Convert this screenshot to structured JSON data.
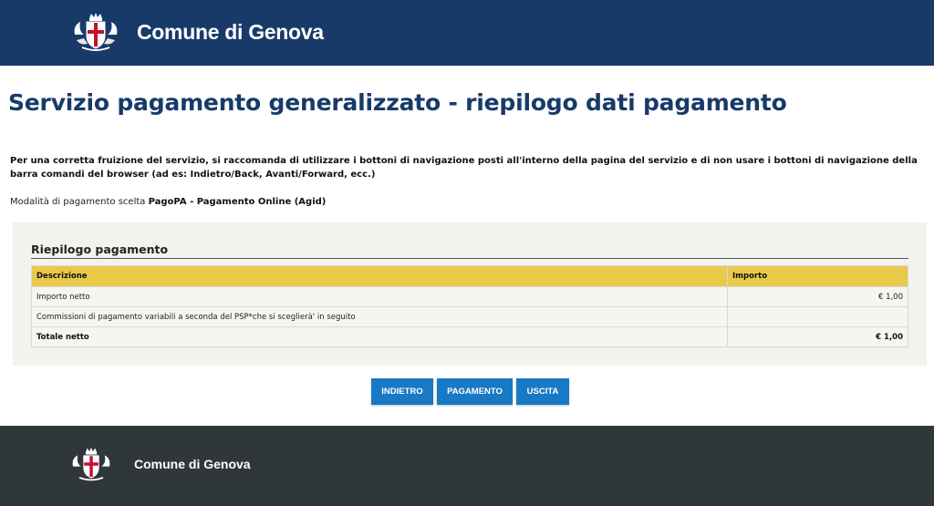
{
  "header": {
    "site_name": "Comune di Genova"
  },
  "page": {
    "title": "Servizio pagamento generalizzato - riepilogo dati pagamento"
  },
  "notice": "Per una corretta fruizione del servizio, si raccomanda di utilizzare i bottoni di navigazione posti all'interno della pagina del servizio e di non usare i bottoni di navigazione della barra comandi del browser (ad es: Indietro/Back, Avanti/Forward, ecc.)",
  "payment_method": {
    "label": "Modalità di pagamento scelta",
    "value": "PagoPA - Pagamento Online (Agid)"
  },
  "summary": {
    "title": "Riepilogo pagamento",
    "columns": {
      "description": "Descrizione",
      "amount": "Importo"
    },
    "rows": [
      {
        "description": "Importo netto",
        "amount": "€ 1,00"
      },
      {
        "description": "Commissioni di pagamento variabili a seconda del PSP*che si sceglierà' in seguito",
        "amount": ""
      }
    ],
    "total": {
      "description": "Totale netto",
      "amount": "€ 1,00"
    }
  },
  "buttons": {
    "back": "INDIETRO",
    "pay": "PAGAMENTO",
    "exit": "USCITA"
  },
  "footer": {
    "site_name": "Comune di Genova"
  },
  "colors": {
    "header_bg": "#173a69",
    "footer_bg": "#30373b",
    "table_header": "#e9c94a",
    "button": "#1879c4"
  }
}
